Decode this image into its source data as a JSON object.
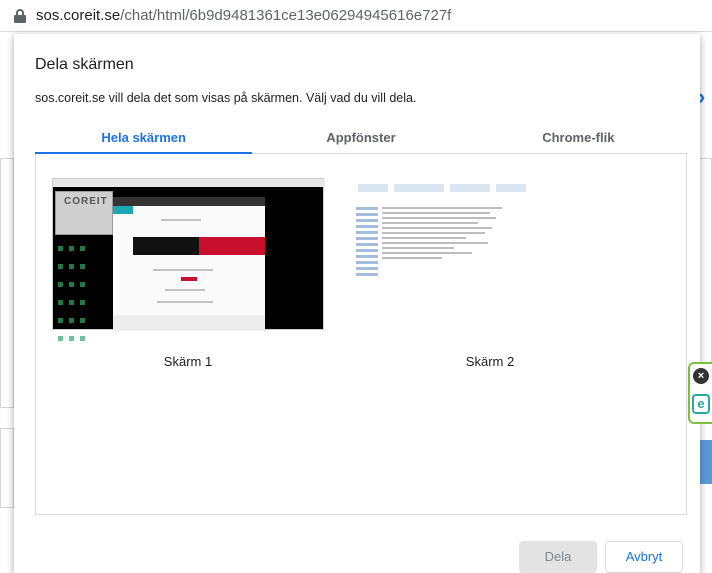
{
  "browser": {
    "url_host": "sos.coreit.se",
    "url_path": "/chat/html/6b9d9481361ce13e06294945616e727f"
  },
  "dialog": {
    "title": "Dela skärmen",
    "description": "sos.coreit.se vill dela det som visas på skärmen. Välj vad du vill dela.",
    "tabs": [
      {
        "label": "Hela skärmen",
        "active": true
      },
      {
        "label": "Appfönster",
        "active": false
      },
      {
        "label": "Chrome-flik",
        "active": false
      }
    ],
    "screens": [
      {
        "label": "Skärm 1",
        "thumbnail_logo": "COREIT"
      },
      {
        "label": "Skärm 2"
      }
    ],
    "buttons": {
      "share": "Dela",
      "cancel": "Avbryt"
    }
  },
  "extension": {
    "close_icon": "close-icon",
    "logo_letter": "e"
  },
  "colors": {
    "accent": "#1a73e8",
    "disabled_button_bg": "#e3e3e3",
    "extension_border": "#7fbf3f"
  }
}
